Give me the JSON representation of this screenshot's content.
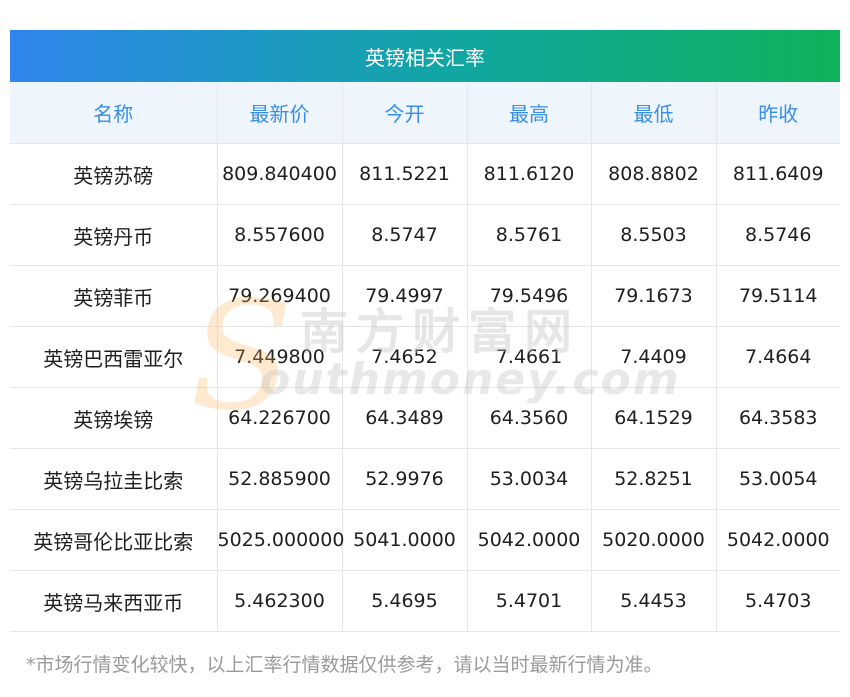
{
  "title": "英镑相关汇率",
  "columns": [
    "名称",
    "最新价",
    "今开",
    "最高",
    "最低",
    "昨收"
  ],
  "rows": [
    [
      "英镑苏磅",
      "809.840400",
      "811.5221",
      "811.6120",
      "808.8802",
      "811.6409"
    ],
    [
      "英镑丹币",
      "8.557600",
      "8.5747",
      "8.5761",
      "8.5503",
      "8.5746"
    ],
    [
      "英镑菲币",
      "79.269400",
      "79.4997",
      "79.5496",
      "79.1673",
      "79.5114"
    ],
    [
      "英镑巴西雷亚尔",
      "7.449800",
      "7.4652",
      "7.4661",
      "7.4409",
      "7.4664"
    ],
    [
      "英镑埃镑",
      "64.226700",
      "64.3489",
      "64.3560",
      "64.1529",
      "64.3583"
    ],
    [
      "英镑乌拉圭比索",
      "52.885900",
      "52.9976",
      "53.0034",
      "52.8251",
      "53.0054"
    ],
    [
      "英镑哥伦比亚比索",
      "5025.000000",
      "5041.0000",
      "5042.0000",
      "5020.0000",
      "5042.0000"
    ],
    [
      "英镑马来西亚币",
      "5.462300",
      "5.4695",
      "5.4701",
      "5.4453",
      "5.4703"
    ]
  ],
  "footnote": "*市场行情变化较快，以上汇率行情数据仅供参考，请以当时最新行情为准。",
  "watermark": {
    "logo_letter": "S",
    "cn": "南方财富网",
    "en": "outhmoney.com"
  },
  "colors": {
    "header_gradient_start": "#2f86ee",
    "header_gradient_end": "#0eb35a",
    "column_header_text": "#3a8ee6",
    "column_header_bg": "#eef5fd"
  }
}
